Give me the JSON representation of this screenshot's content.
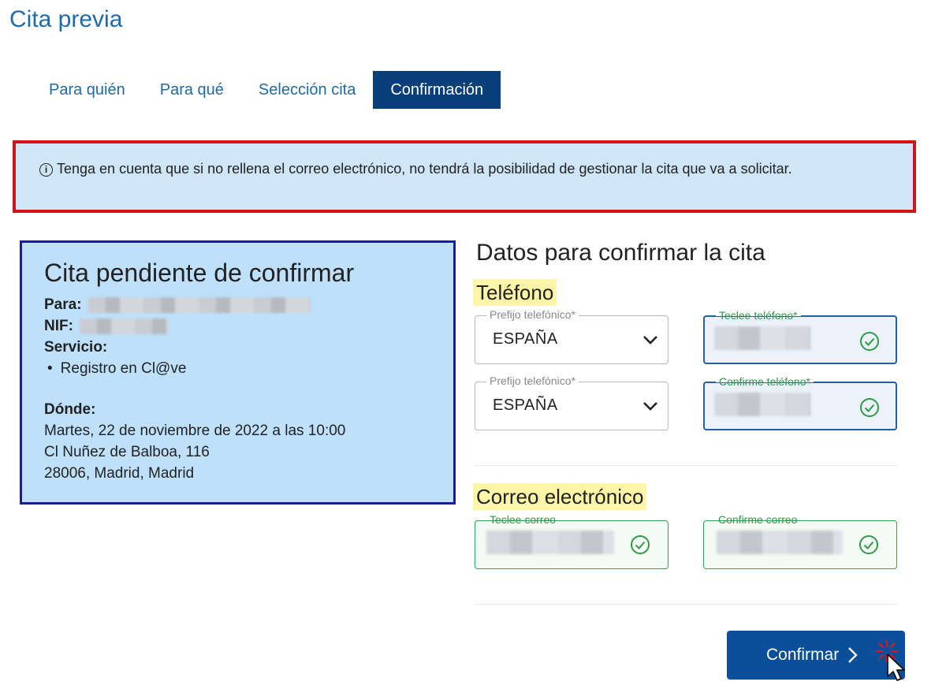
{
  "page": {
    "title": "Cita previa"
  },
  "tabs": [
    {
      "label": "Para quién",
      "active": false
    },
    {
      "label": "Para qué",
      "active": false
    },
    {
      "label": "Selección cita",
      "active": false
    },
    {
      "label": "Confirmación",
      "active": true
    }
  ],
  "alert": {
    "icon": "info-icon",
    "text": "Tenga en cuenta que si no rellena el correo electrónico, no tendrá la posibilidad de gestionar la cita que va a solicitar."
  },
  "summary": {
    "title": "Cita pendiente de confirmar",
    "para_label": "Para:",
    "nif_label": "NIF:",
    "servicio_label": "Servicio:",
    "services": [
      "Registro en Cl@ve"
    ],
    "donde_label": "Dónde:",
    "donde_lines": [
      "Martes, 22 de noviembre de 2022 a las 10:00",
      "Cl Nuñez de Balboa, 116",
      "28006, Madrid, Madrid"
    ]
  },
  "form": {
    "title": "Datos para confirmar la cita",
    "phone_section": "Teléfono",
    "email_section": "Correo electrónico",
    "prefix1": {
      "legend": "Prefijo telefónico*",
      "value": "ESPAÑA"
    },
    "prefix2": {
      "legend": "Prefijo telefónico*",
      "value": "ESPAÑA"
    },
    "phone": {
      "legend": "Teclee teléfono*"
    },
    "phone_confirm": {
      "legend": "Confirme teléfono*"
    },
    "email": {
      "legend": "Teclee correo"
    },
    "email_confirm": {
      "legend": "Confirme correo"
    }
  },
  "actions": {
    "confirm_label": "Confirmar"
  },
  "colors": {
    "primary": "#0b4e9a",
    "alert_border": "#d4121c",
    "valid": "#2e9a45",
    "highlight": "#fdf6a8"
  }
}
